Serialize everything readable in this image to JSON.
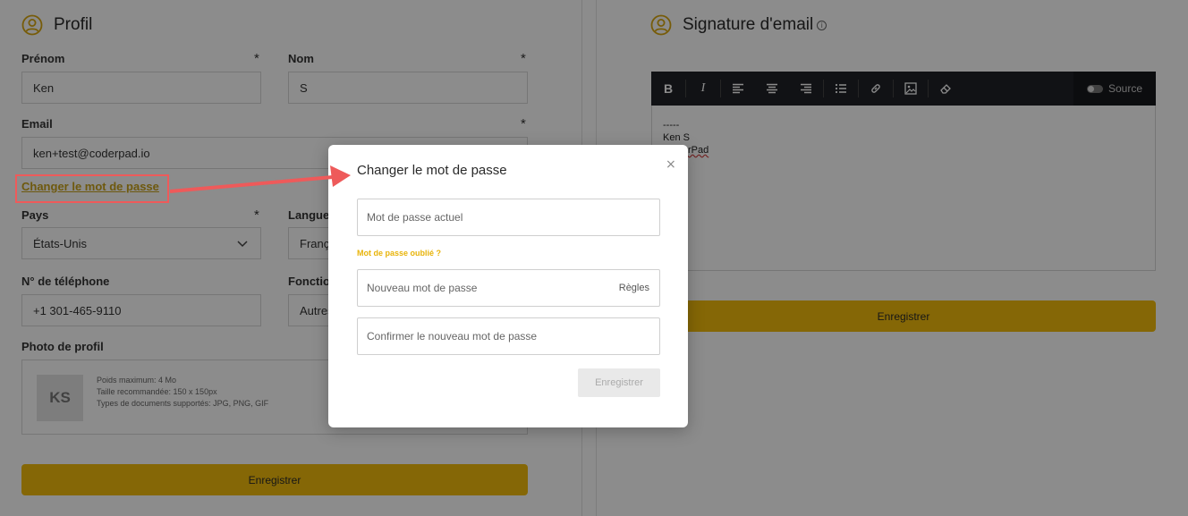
{
  "profile": {
    "title": "Profil",
    "first_name_label": "Prénom",
    "first_name_value": "Ken",
    "last_name_label": "Nom",
    "last_name_value": "S",
    "required_marker": "*",
    "email_label": "Email",
    "email_value": "ken+test@coderpad.io",
    "change_password_link": "Changer le mot de passe",
    "country_label": "Pays",
    "country_value": "États-Unis",
    "language_label": "Langue",
    "language_value": "Franç",
    "phone_label": "N° de téléphone",
    "phone_value": "+1 301-465-9110",
    "function_label": "Fonction",
    "function_value": "Autres",
    "photo_label": "Photo de profil",
    "avatar_initials": "KS",
    "photo_info": [
      "Poids maximum: 4 Mo",
      "Taille recommandée: 150 x 150px",
      "Types de documents supportés: JPG, PNG, GIF"
    ],
    "save_label": "Enregistrer"
  },
  "signature": {
    "title": "Signature d'email",
    "info_glyph": "i",
    "toolbar": {
      "bold": "B",
      "italic": "I",
      "source_label": "Source"
    },
    "content_lines": [
      "-----",
      "Ken S",
      "rPad"
    ],
    "save_label": "Enregistrer"
  },
  "modal": {
    "title": "Changer le mot de passe",
    "close_glyph": "×",
    "current_password_placeholder": "Mot de passe actuel",
    "forgot_password_link": "Mot de passe oublié ?",
    "new_password_placeholder": "Nouveau mot de passe",
    "rules_label": "Règles",
    "confirm_password_placeholder": "Confirmer le nouveau mot de passe",
    "save_label": "Enregistrer"
  },
  "colors": {
    "accent": "#f2bc0c",
    "link": "#c9a21a",
    "annotation": "#ee5a5a",
    "toolbar_bg": "#1f2127"
  }
}
